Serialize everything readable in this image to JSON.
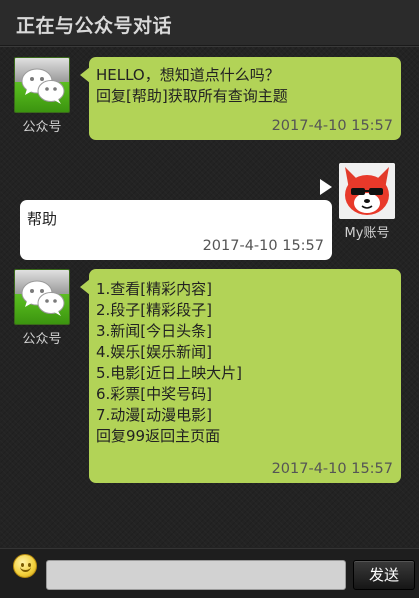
{
  "header": {
    "title": "正在与公众号对话"
  },
  "messages": [
    {
      "sender": "公众号",
      "avatar_icon": "wechat-icon",
      "lines": [
        "HELLO，想知道点什么吗？",
        "回复[帮助]获取所有查询主题"
      ],
      "time": "2017-4-10 15:57"
    },
    {
      "sender": "My账号",
      "avatar_icon": "fox-avatar",
      "lines": [
        "帮助"
      ],
      "time": "2017-4-10 15:57"
    },
    {
      "sender": "公众号",
      "avatar_icon": "wechat-icon",
      "lines": [
        "1.查看[精彩内容]",
        "2.段子[精彩段子]",
        "3.新闻[今日头条]",
        "4.娱乐[娱乐新闻]",
        "5.电影[近日上映大片]",
        "6.彩票[中奖号码]",
        "7.动漫[动漫电影]",
        "回复99返回主页面"
      ],
      "time": "2017-4-10 15:57"
    }
  ],
  "footer": {
    "input_value": "",
    "send_label": "发送",
    "emoji_icon": "smiley-icon"
  },
  "colors": {
    "incoming_bubble": "#b2d357",
    "outgoing_bubble": "#ffffff",
    "background": "#242424"
  }
}
